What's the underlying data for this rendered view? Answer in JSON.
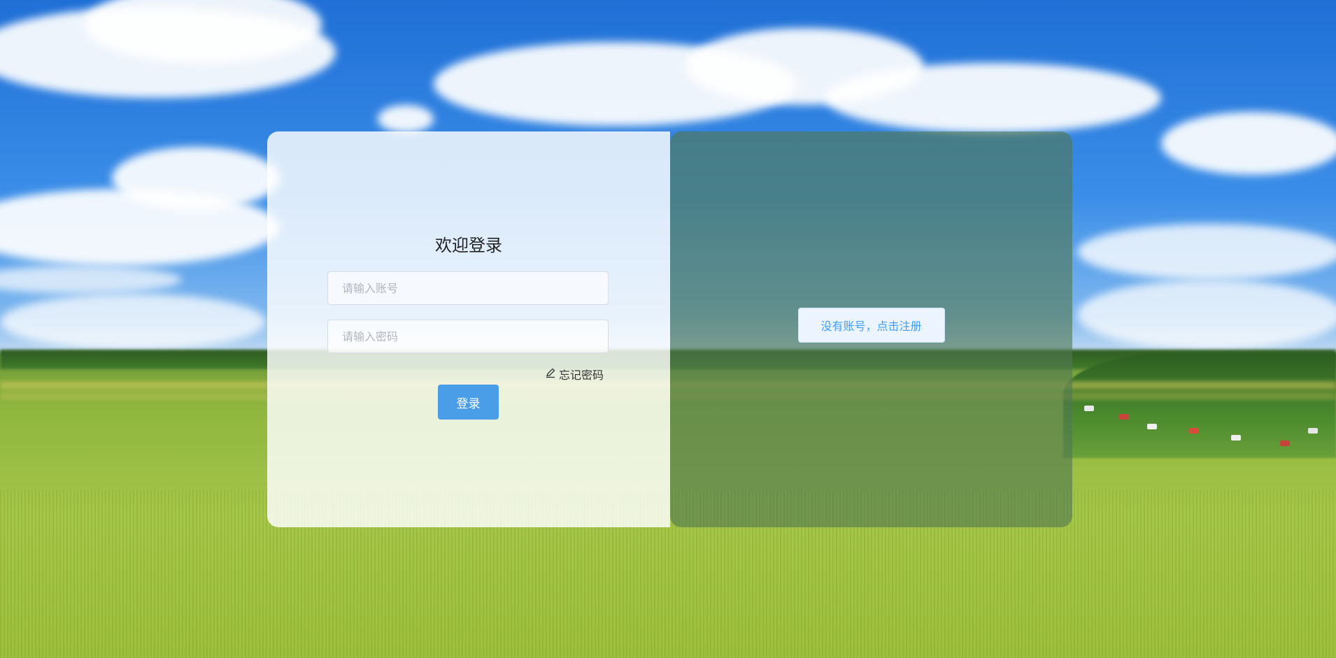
{
  "login": {
    "title": "欢迎登录",
    "account_placeholder": "请输入账号",
    "password_placeholder": "请输入密码",
    "forgot_label": "忘记密码",
    "login_label": "登录"
  },
  "register": {
    "label": "没有账号，点击注册"
  },
  "colors": {
    "primary": "#409eff",
    "login_button": "#4a9ee8",
    "register_bg": "#ecf5ff",
    "right_panel_overlay": "#50785099"
  },
  "icons": {
    "forgot": "edit-pencil-icon"
  },
  "background": "sky-and-wheat-field-landscape"
}
